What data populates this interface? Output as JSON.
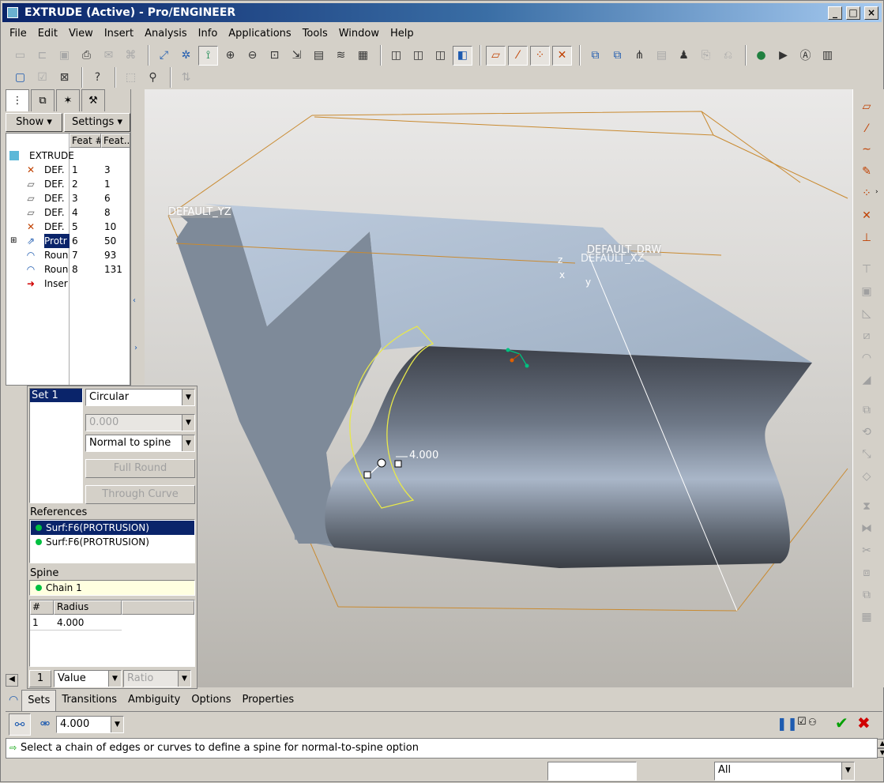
{
  "window": {
    "title": "EXTRUDE (Active) - Pro/ENGINEER"
  },
  "menu": [
    "File",
    "Edit",
    "View",
    "Insert",
    "Analysis",
    "Info",
    "Applications",
    "Tools",
    "Window",
    "Help"
  ],
  "nav": {
    "show_label": "Show",
    "settings_label": "Settings"
  },
  "tree": {
    "col_feat_num": "Feat #",
    "col_feat_id": "Feat...",
    "root": "EXTRUDE",
    "rows": [
      {
        "name": "DEF.",
        "num": "1",
        "id": "3",
        "icon": "csys-icon"
      },
      {
        "name": "DEF.",
        "num": "2",
        "id": "1",
        "icon": "datum-plane-icon"
      },
      {
        "name": "DEF.",
        "num": "3",
        "id": "6",
        "icon": "datum-plane-icon"
      },
      {
        "name": "DEF.",
        "num": "4",
        "id": "8",
        "icon": "datum-plane-icon"
      },
      {
        "name": "DEF.",
        "num": "5",
        "id": "10",
        "icon": "csys-icon"
      },
      {
        "name": "Protr",
        "num": "6",
        "id": "50",
        "icon": "protrusion-icon"
      },
      {
        "name": "Roun",
        "num": "7",
        "id": "93",
        "icon": "round-icon"
      },
      {
        "name": "Roun",
        "num": "8",
        "id": "131",
        "icon": "round-icon"
      },
      {
        "name": "Inser",
        "num": "",
        "id": "",
        "icon": "insert-here-icon"
      }
    ]
  },
  "sets": {
    "set_item": "Set 1",
    "shape_select": "Circular",
    "conic_value": "0.000",
    "cross_section_select": "Normal to spine",
    "full_round_label": "Full Round",
    "through_curve_label": "Through Curve",
    "references_label": "References",
    "references": [
      "Surf:F6(PROTRUSION)",
      "Surf:F6(PROTRUSION)"
    ],
    "spine_label": "Spine",
    "spine_value": "Chain 1",
    "radius_table": {
      "col_num": "#",
      "col_radius": "Radius",
      "rows": [
        {
          "num": "1",
          "radius": "4.000"
        }
      ]
    },
    "bottom_num": "1",
    "value_select": "Value",
    "ratio_select": "Ratio"
  },
  "viewport": {
    "label_yz": "DEFAULT_YZ",
    "label_drw": "DEFAULT_DRW",
    "label_xz": "DEFAULT_XZ",
    "axis_z": "z",
    "axis_x": "x",
    "axis_y": "y",
    "dimension": "4.000"
  },
  "dashboard": {
    "tabs": [
      "Sets",
      "Transitions",
      "Ambiguity",
      "Options",
      "Properties"
    ],
    "radius_value": "4.000"
  },
  "message": "Select a chain of edges or curves to define a spine for normal-to-spine option",
  "status": {
    "filter": "All",
    "input": ""
  }
}
